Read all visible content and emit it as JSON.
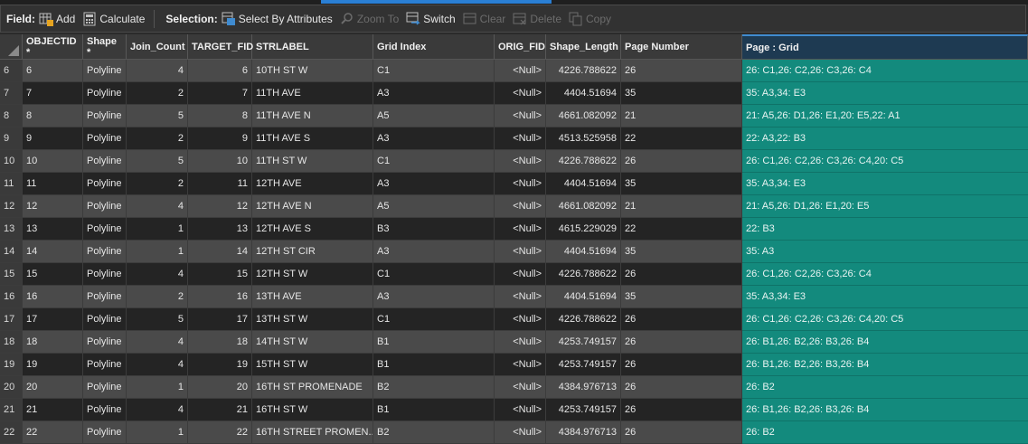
{
  "toolbar": {
    "field_label": "Field:",
    "add": "Add",
    "calculate": "Calculate",
    "selection_label": "Selection:",
    "select_by_attributes": "Select By Attributes",
    "zoom_to": "Zoom To",
    "switch": "Switch",
    "clear": "Clear",
    "delete": "Delete",
    "copy": "Copy"
  },
  "columns": [
    "OBJECTID *",
    "Shape *",
    "Join_Count",
    "TARGET_FID",
    "STRLABEL",
    "Grid Index",
    "ORIG_FID",
    "Shape_Length",
    "Page Number",
    "Page : Grid"
  ],
  "rows": [
    {
      "rn": "6",
      "oid": "6",
      "shape": "Polyline",
      "join": "4",
      "tfid": "6",
      "str": "10TH ST W",
      "grid": "C1",
      "orig": "<Null>",
      "len": "4226.788622",
      "page": "26",
      "pg": "26: C1,26: C2,26: C3,26: C4"
    },
    {
      "rn": "7",
      "oid": "7",
      "shape": "Polyline",
      "join": "2",
      "tfid": "7",
      "str": "11TH AVE",
      "grid": "A3",
      "orig": "<Null>",
      "len": "4404.51694",
      "page": "35",
      "pg": "35: A3,34: E3"
    },
    {
      "rn": "8",
      "oid": "8",
      "shape": "Polyline",
      "join": "5",
      "tfid": "8",
      "str": "11TH AVE N",
      "grid": "A5",
      "orig": "<Null>",
      "len": "4661.082092",
      "page": "21",
      "pg": "21: A5,26: D1,26: E1,20: E5,22: A1"
    },
    {
      "rn": "9",
      "oid": "9",
      "shape": "Polyline",
      "join": "2",
      "tfid": "9",
      "str": "11TH AVE S",
      "grid": "A3",
      "orig": "<Null>",
      "len": "4513.525958",
      "page": "22",
      "pg": "22: A3,22: B3"
    },
    {
      "rn": "10",
      "oid": "10",
      "shape": "Polyline",
      "join": "5",
      "tfid": "10",
      "str": "11TH ST W",
      "grid": "C1",
      "orig": "<Null>",
      "len": "4226.788622",
      "page": "26",
      "pg": "26: C1,26: C2,26: C3,26: C4,20: C5"
    },
    {
      "rn": "11",
      "oid": "11",
      "shape": "Polyline",
      "join": "2",
      "tfid": "11",
      "str": "12TH AVE",
      "grid": "A3",
      "orig": "<Null>",
      "len": "4404.51694",
      "page": "35",
      "pg": "35: A3,34: E3"
    },
    {
      "rn": "12",
      "oid": "12",
      "shape": "Polyline",
      "join": "4",
      "tfid": "12",
      "str": "12TH AVE N",
      "grid": "A5",
      "orig": "<Null>",
      "len": "4661.082092",
      "page": "21",
      "pg": "21: A5,26: D1,26: E1,20: E5"
    },
    {
      "rn": "13",
      "oid": "13",
      "shape": "Polyline",
      "join": "1",
      "tfid": "13",
      "str": "12TH AVE S",
      "grid": "B3",
      "orig": "<Null>",
      "len": "4615.229029",
      "page": "22",
      "pg": "22: B3"
    },
    {
      "rn": "14",
      "oid": "14",
      "shape": "Polyline",
      "join": "1",
      "tfid": "14",
      "str": "12TH ST CIR",
      "grid": "A3",
      "orig": "<Null>",
      "len": "4404.51694",
      "page": "35",
      "pg": "35: A3"
    },
    {
      "rn": "15",
      "oid": "15",
      "shape": "Polyline",
      "join": "4",
      "tfid": "15",
      "str": "12TH ST W",
      "grid": "C1",
      "orig": "<Null>",
      "len": "4226.788622",
      "page": "26",
      "pg": "26: C1,26: C2,26: C3,26: C4"
    },
    {
      "rn": "16",
      "oid": "16",
      "shape": "Polyline",
      "join": "2",
      "tfid": "16",
      "str": "13TH AVE",
      "grid": "A3",
      "orig": "<Null>",
      "len": "4404.51694",
      "page": "35",
      "pg": "35: A3,34: E3"
    },
    {
      "rn": "17",
      "oid": "17",
      "shape": "Polyline",
      "join": "5",
      "tfid": "17",
      "str": "13TH ST W",
      "grid": "C1",
      "orig": "<Null>",
      "len": "4226.788622",
      "page": "26",
      "pg": "26: C1,26: C2,26: C3,26: C4,20: C5"
    },
    {
      "rn": "18",
      "oid": "18",
      "shape": "Polyline",
      "join": "4",
      "tfid": "18",
      "str": "14TH ST W",
      "grid": "B1",
      "orig": "<Null>",
      "len": "4253.749157",
      "page": "26",
      "pg": "26: B1,26: B2,26: B3,26: B4"
    },
    {
      "rn": "19",
      "oid": "19",
      "shape": "Polyline",
      "join": "4",
      "tfid": "19",
      "str": "15TH ST W",
      "grid": "B1",
      "orig": "<Null>",
      "len": "4253.749157",
      "page": "26",
      "pg": "26: B1,26: B2,26: B3,26: B4"
    },
    {
      "rn": "20",
      "oid": "20",
      "shape": "Polyline",
      "join": "1",
      "tfid": "20",
      "str": "16TH ST PROMENADE",
      "grid": "B2",
      "orig": "<Null>",
      "len": "4384.976713",
      "page": "26",
      "pg": "26: B2"
    },
    {
      "rn": "21",
      "oid": "21",
      "shape": "Polyline",
      "join": "4",
      "tfid": "21",
      "str": "16TH ST W",
      "grid": "B1",
      "orig": "<Null>",
      "len": "4253.749157",
      "page": "26",
      "pg": "26: B1,26: B2,26: B3,26: B4"
    },
    {
      "rn": "22",
      "oid": "22",
      "shape": "Polyline",
      "join": "1",
      "tfid": "22",
      "str": "16TH STREET PROMEN...",
      "grid": "B2",
      "orig": "<Null>",
      "len": "4384.976713",
      "page": "26",
      "pg": "26: B2"
    }
  ]
}
